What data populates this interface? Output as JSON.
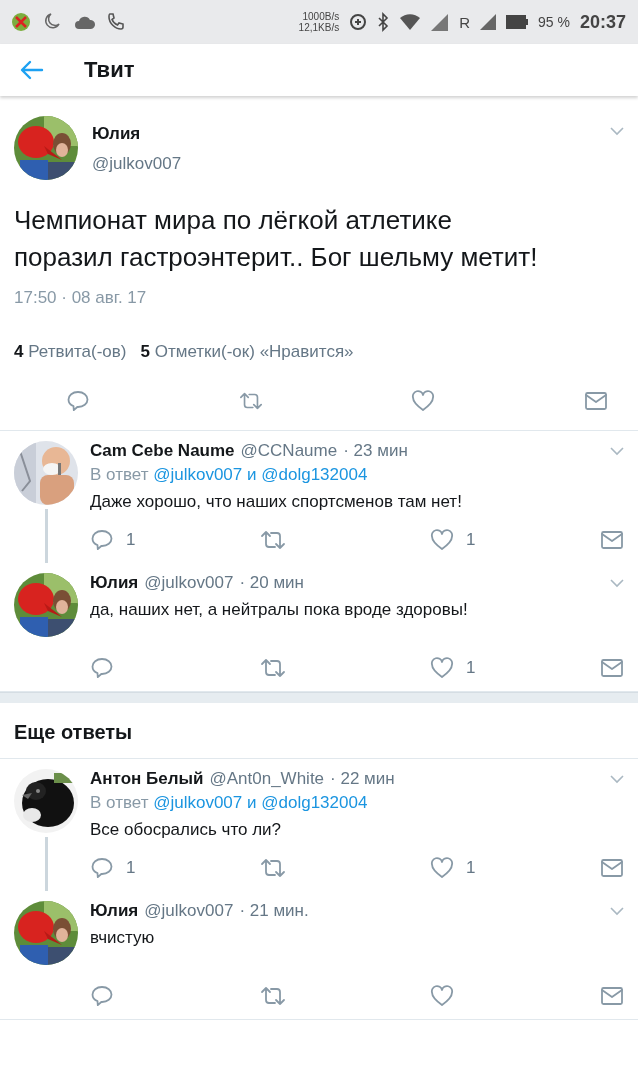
{
  "status_bar": {
    "speed_up": "1000B/s",
    "speed_down": "12,1KB/s",
    "network": "R",
    "battery": "95 %",
    "time": "20:37"
  },
  "header": {
    "title": "Твит"
  },
  "tweet": {
    "name": "Юлия",
    "handle": "@julkov007",
    "text": "Чемпионат мира по лёгкой атлетике поразил гастроэнтерит.. Бог шельму метит!",
    "timestamp": "17:50 · 08 авг. 17",
    "stats": [
      {
        "count": "4",
        "label": "Ретвита(-ов)"
      },
      {
        "count": "5",
        "label": "Отметки(-ок) «Нравится»"
      }
    ]
  },
  "sections": [
    {
      "replies": [
        {
          "name": "Cam Cebe Naume",
          "handle": "@CCNaume",
          "time": "· 23 мин",
          "reply_to": {
            "prefix": "В ответ",
            "users": [
              "@julkov007",
              "@dolg132004"
            ],
            "joiner": "и"
          },
          "text": "Даже хорошо, что наших спортсменов там нет!",
          "reply_count": "1",
          "like_count": "1"
        },
        {
          "name": "Юлия",
          "handle": "@julkov007",
          "time": "· 20 мин",
          "text": "да, наших нет, а нейтралы пока вроде здоровы!",
          "like_count": "1"
        }
      ]
    },
    {
      "title": "Еще ответы",
      "replies": [
        {
          "name": "Антон Белый",
          "handle": "@Ant0n_White",
          "time": "· 22 мин",
          "reply_to": {
            "prefix": "В ответ",
            "users": [
              "@julkov007",
              "@dolg132004"
            ],
            "joiner": "и"
          },
          "text": "Все обосрались что ли?",
          "reply_count": "1",
          "like_count": "1"
        },
        {
          "name": "Юлия",
          "handle": "@julkov007",
          "time": "· 21 мин.",
          "text": "вчистую"
        }
      ]
    }
  ]
}
